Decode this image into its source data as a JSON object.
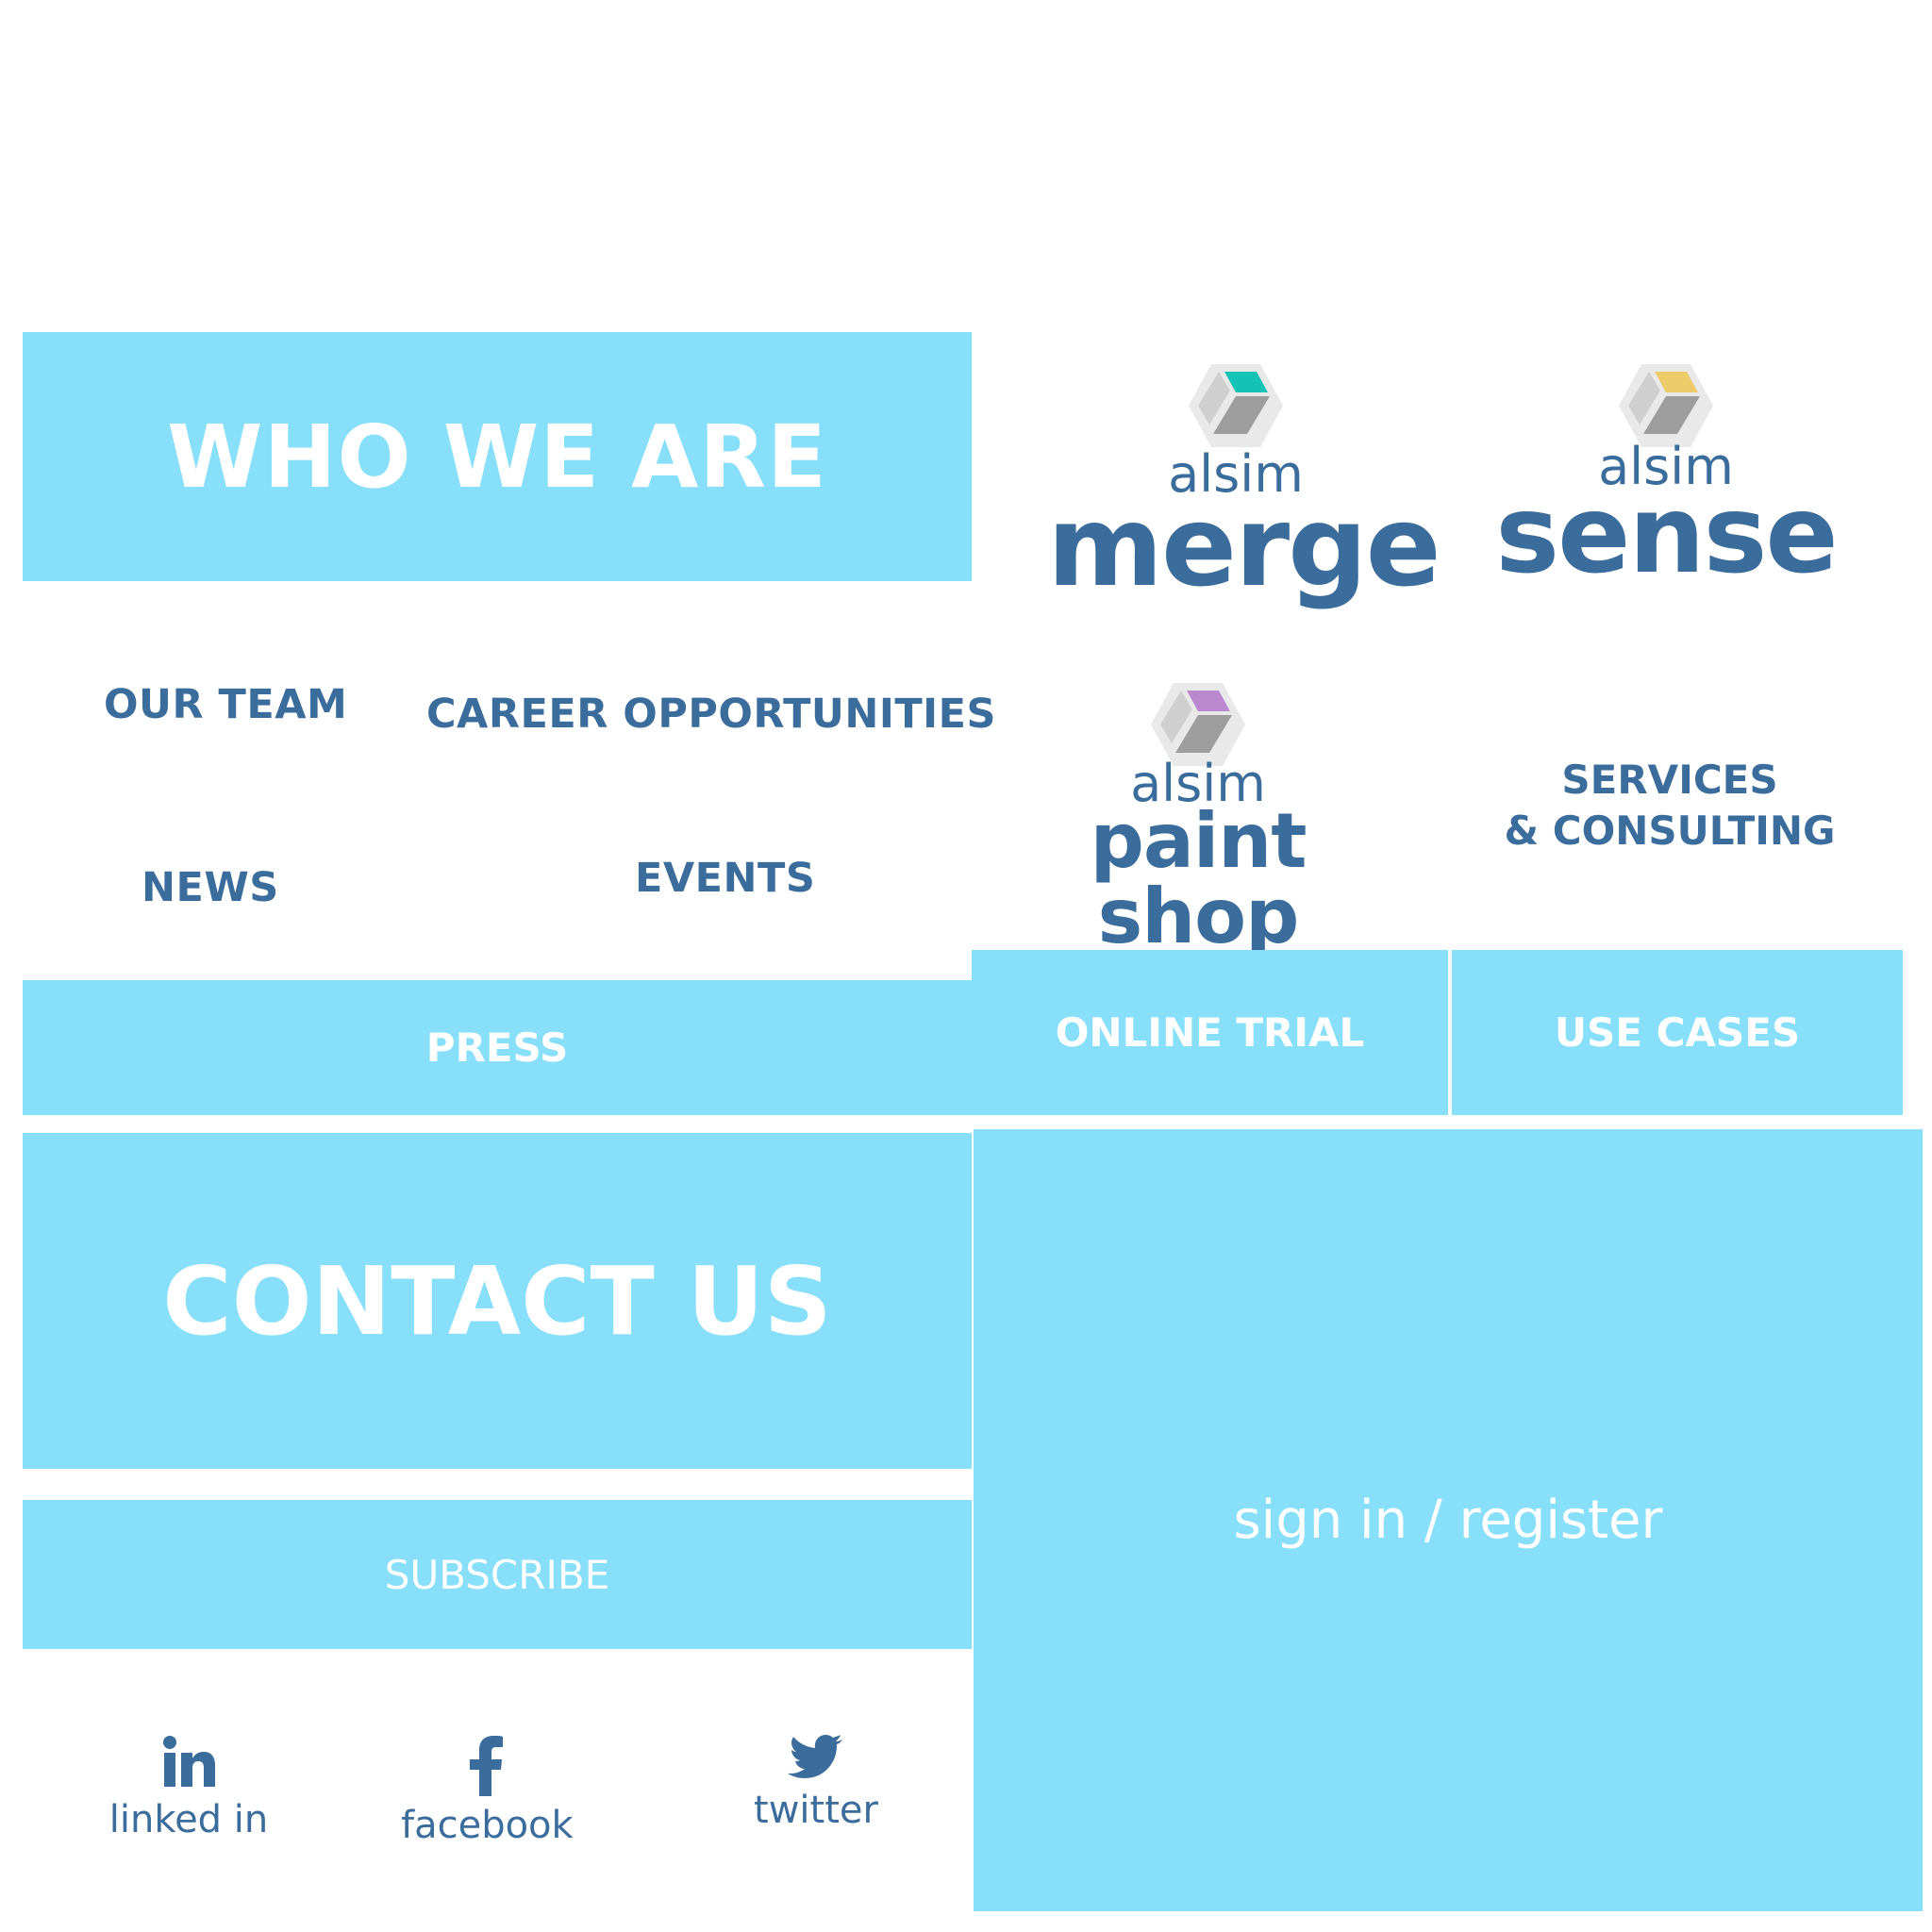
{
  "about": {
    "who_we_are": "WHO WE ARE",
    "links": {
      "our_team": "OUR TEAM",
      "career_opportunities": "CAREER OPPORTUNITIES",
      "news": "NEWS",
      "events": "EVENTS"
    },
    "press": "PRESS"
  },
  "products": {
    "merge": {
      "brand": "alsim",
      "name": "merge",
      "accent_color": "#14c2b6"
    },
    "sense": {
      "brand": "alsim",
      "name": "sense",
      "accent_color": "#eccb6b"
    },
    "paint_shop": {
      "brand": "alsim",
      "name": "paint shop",
      "accent_color": "#b988cf"
    },
    "services": {
      "line1": "SERVICES",
      "line2": "& CONSULTING"
    },
    "online_trial": "ONLINE TRIAL",
    "use_cases": "USE CASES"
  },
  "contact": {
    "contact_us": "CONTACT US",
    "subscribe": "SUBSCRIBE",
    "sign_in_register": "sign in / register"
  },
  "social": {
    "linkedin": {
      "label": "linked in",
      "icon": "linkedin-icon"
    },
    "facebook": {
      "label": "facebook",
      "icon": "facebook-icon"
    },
    "twitter": {
      "label": "twitter",
      "icon": "twitter-icon"
    }
  },
  "colors": {
    "tile_background": "#87dff9",
    "primary_text": "#3b6d9c",
    "tile_text": "#ffffff"
  }
}
